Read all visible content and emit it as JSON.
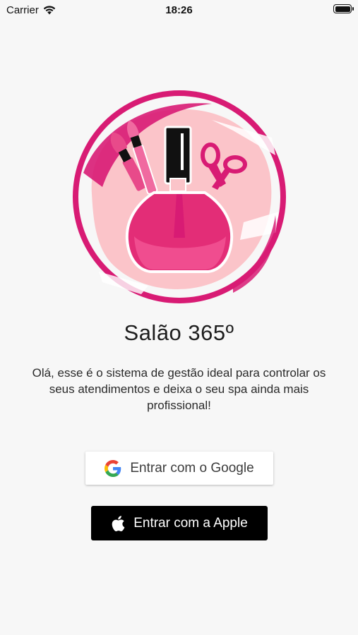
{
  "status_bar": {
    "carrier": "Carrier",
    "time": "18:26",
    "battery_level": 1.0
  },
  "logo": {
    "icon": "nail-polish-logo-icon"
  },
  "app_title": "Salão 365º",
  "welcome_text": "Olá, esse é o sistema de gestão ideal para controlar os seus atendimentos e deixa o seu spa ainda mais profissional!",
  "buttons": {
    "google_label": "Entrar com o Google",
    "apple_label": "Entrar com a Apple"
  },
  "colors": {
    "brand_pink": "#d81b74",
    "light_pink": "#fbc4c9",
    "background": "#f7f7f7",
    "apple_button": "#000000"
  }
}
